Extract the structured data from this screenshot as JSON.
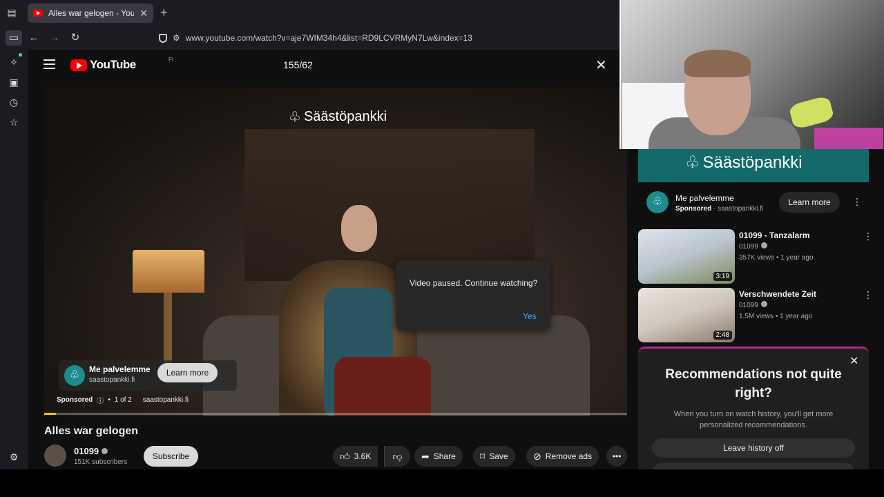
{
  "browser": {
    "tab_title": "Alles war gelogen - YouTube",
    "url": "www.youtube.com/watch?v=aje7WIM34h4&list=RD9LCVRMyN7Lw&index=13"
  },
  "header": {
    "logo_text": "YouTube",
    "country_code": "FI",
    "search_query": "155/62"
  },
  "player": {
    "brand_overlay": "Säästöpankki",
    "ad_card": {
      "title": "Me palvelemme",
      "site": "saastopankki.fi",
      "button": "Learn more"
    },
    "ad_meta": {
      "sponsored": "Sponsored",
      "count": "1 of 2",
      "site": "saastopankki.fi"
    },
    "progress_fraction": 0.02,
    "dialog": {
      "message": "Video paused. Continue watching?",
      "yes": "Yes"
    }
  },
  "video": {
    "title": "Alles war gelogen",
    "channel": "01099",
    "subscribers": "151K subscribers",
    "subscribe": "Subscribe",
    "likes": "3.6K",
    "share": "Share",
    "save": "Save",
    "remove_ads": "Remove ads"
  },
  "sidebar_ad": {
    "banner": "Säästöpankki",
    "title": "Me palvelemme",
    "sponsored": "Sponsored",
    "site": "saastopankki.fi",
    "button": "Learn more"
  },
  "recommendations": [
    {
      "title": "01099 - Tanzalarm",
      "channel": "01099",
      "meta": "357K views • 1 year ago",
      "duration": "3:19"
    },
    {
      "title": "Verschwendete Zeit",
      "channel": "01099",
      "meta": "1.5M views • 1 year ago",
      "duration": "2:48"
    }
  ],
  "reco_panel": {
    "heading": "Recommendations not quite right?",
    "body": "When you turn on watch history, you'll get more personalized recommendations.",
    "button": "Leave history off"
  }
}
